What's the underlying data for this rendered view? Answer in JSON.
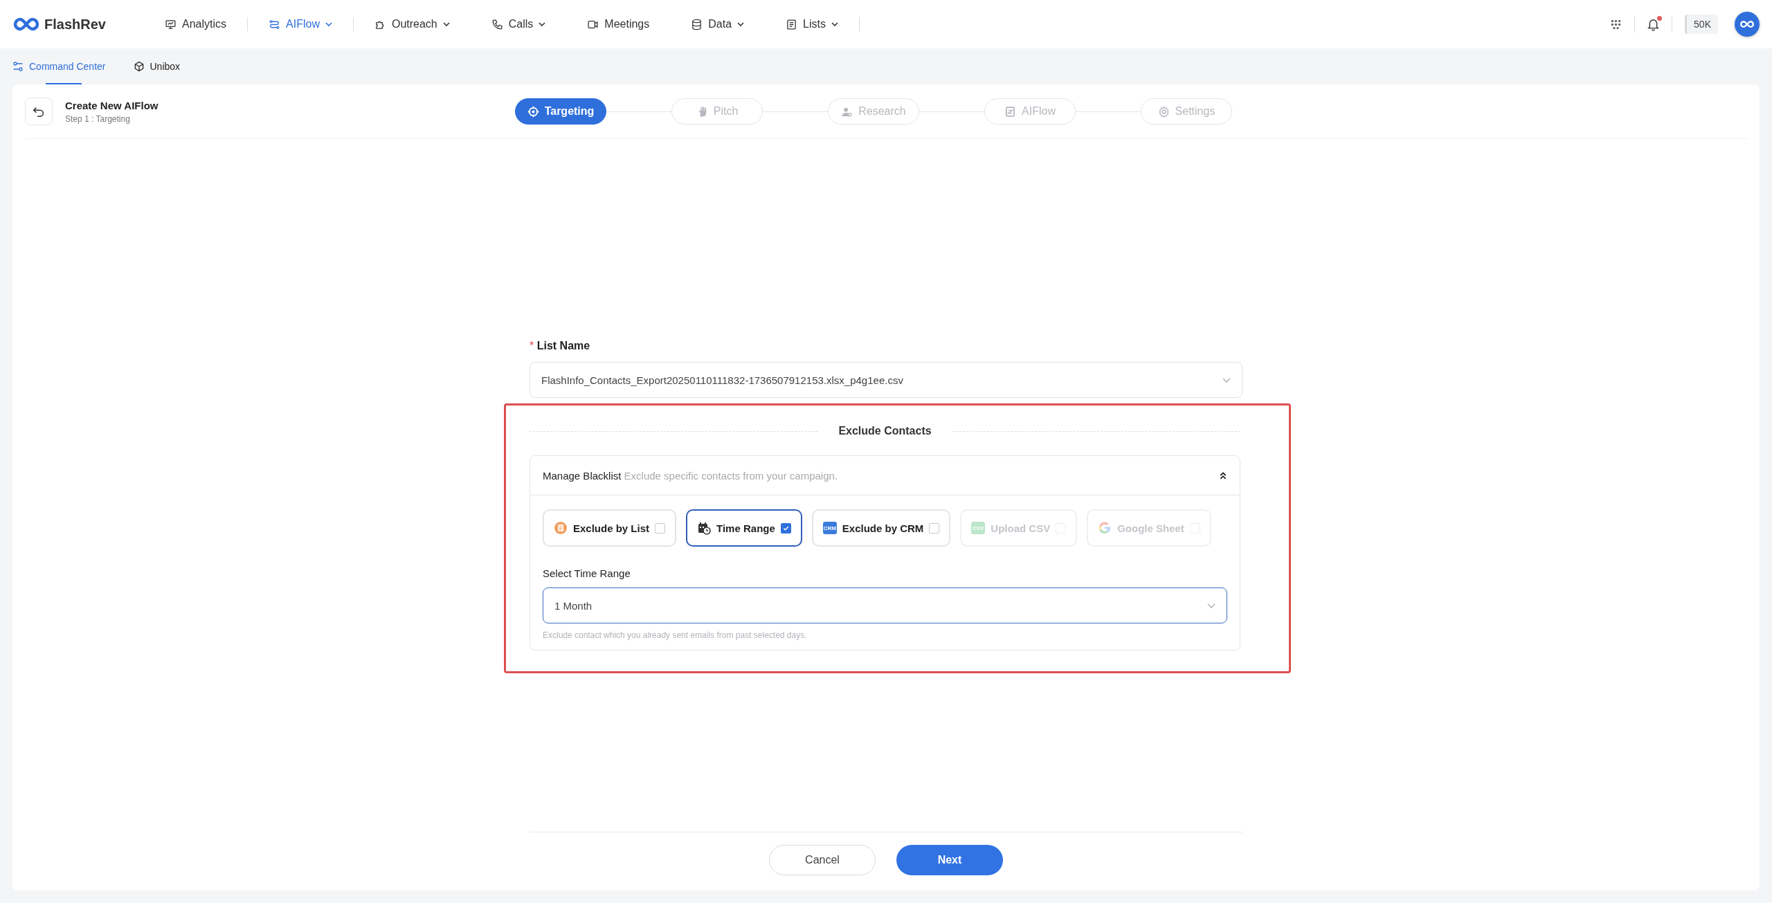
{
  "brand": {
    "name": "FlashRev"
  },
  "nav": {
    "groups": [
      [
        {
          "label": "Analytics",
          "selected": false,
          "dropdown": false
        }
      ],
      [
        {
          "label": "AIFlow",
          "selected": true,
          "dropdown": true
        }
      ],
      [
        {
          "label": "Outreach",
          "selected": false,
          "dropdown": true
        },
        {
          "label": "Calls",
          "selected": false,
          "dropdown": true
        },
        {
          "label": "Meetings",
          "selected": false,
          "dropdown": false
        },
        {
          "label": "Data",
          "selected": false,
          "dropdown": true
        },
        {
          "label": "Lists",
          "selected": false,
          "dropdown": true
        }
      ]
    ],
    "notification_unread": true,
    "credits": "50K"
  },
  "subnav": [
    {
      "label": "Command Center",
      "selected": true
    },
    {
      "label": "Unibox",
      "selected": false
    }
  ],
  "header": {
    "title": "Create New AIFlow",
    "subtitle": "Step 1 : Targeting"
  },
  "steps": [
    {
      "label": "Targeting",
      "selected": true
    },
    {
      "label": "Pitch",
      "selected": false
    },
    {
      "label": "Research",
      "selected": false
    },
    {
      "label": "AIFlow",
      "selected": false
    },
    {
      "label": "Settings",
      "selected": false
    }
  ],
  "list_name": {
    "required_mark": "*",
    "label": "List Name",
    "value": "FlashInfo_Contacts_Export20250110111832-1736507912153.xlsx_p4g1ee.csv"
  },
  "exclude": {
    "title": "Exclude Contacts",
    "panel": {
      "title": "Manage Blacklist",
      "description": "Exclude specific contacts from your campaign.",
      "expanded": true
    },
    "options": [
      {
        "label": "Exclude by List",
        "checked": false,
        "disabled": false
      },
      {
        "label": "Time Range",
        "checked": true,
        "disabled": false
      },
      {
        "label": "Exclude by CRM",
        "icon_text": "CRM",
        "checked": false,
        "disabled": false
      },
      {
        "label": "Upload CSV",
        "icon_text": "CSV",
        "checked": false,
        "disabled": true
      },
      {
        "label": "Google Sheet",
        "checked": false,
        "disabled": true
      }
    ],
    "time_range": {
      "label": "Select Time Range",
      "value": "1 Month",
      "hint": "Exclude contact which you already sent emails from past selected days."
    }
  },
  "buttons": {
    "cancel": "Cancel",
    "next": "Next"
  }
}
